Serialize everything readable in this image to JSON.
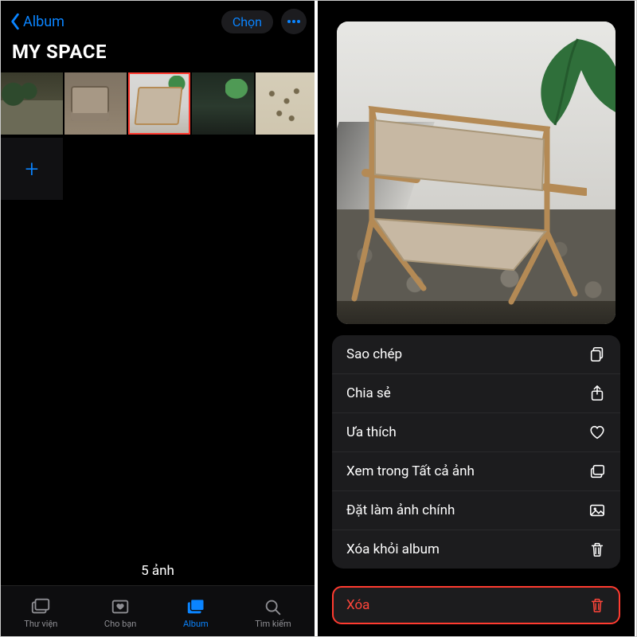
{
  "colors": {
    "accent": "#0a84ff",
    "danger": "#ff453a"
  },
  "left": {
    "back_label": "Album",
    "select_label": "Chọn",
    "title": "MY SPACE",
    "count_text": "5 ảnh",
    "add_glyph": "+",
    "thumbs": [
      {
        "name": "photo-plants"
      },
      {
        "name": "photo-sofa"
      },
      {
        "name": "photo-chair",
        "selected": true
      },
      {
        "name": "photo-leaf"
      },
      {
        "name": "photo-pattern"
      }
    ],
    "tabs": [
      {
        "id": "library",
        "label": "Thư viện"
      },
      {
        "id": "foryou",
        "label": "Cho bạn"
      },
      {
        "id": "album",
        "label": "Album",
        "active": true
      },
      {
        "id": "search",
        "label": "Tìm kiếm"
      }
    ]
  },
  "right": {
    "menu": {
      "copy": "Sao chép",
      "share": "Chia sẻ",
      "favorite": "Ưa thích",
      "show_in_all": "Xem trong Tất cả ảnh",
      "set_key_photo": "Đặt làm ảnh chính",
      "remove_album": "Xóa khỏi album",
      "delete": "Xóa"
    }
  }
}
